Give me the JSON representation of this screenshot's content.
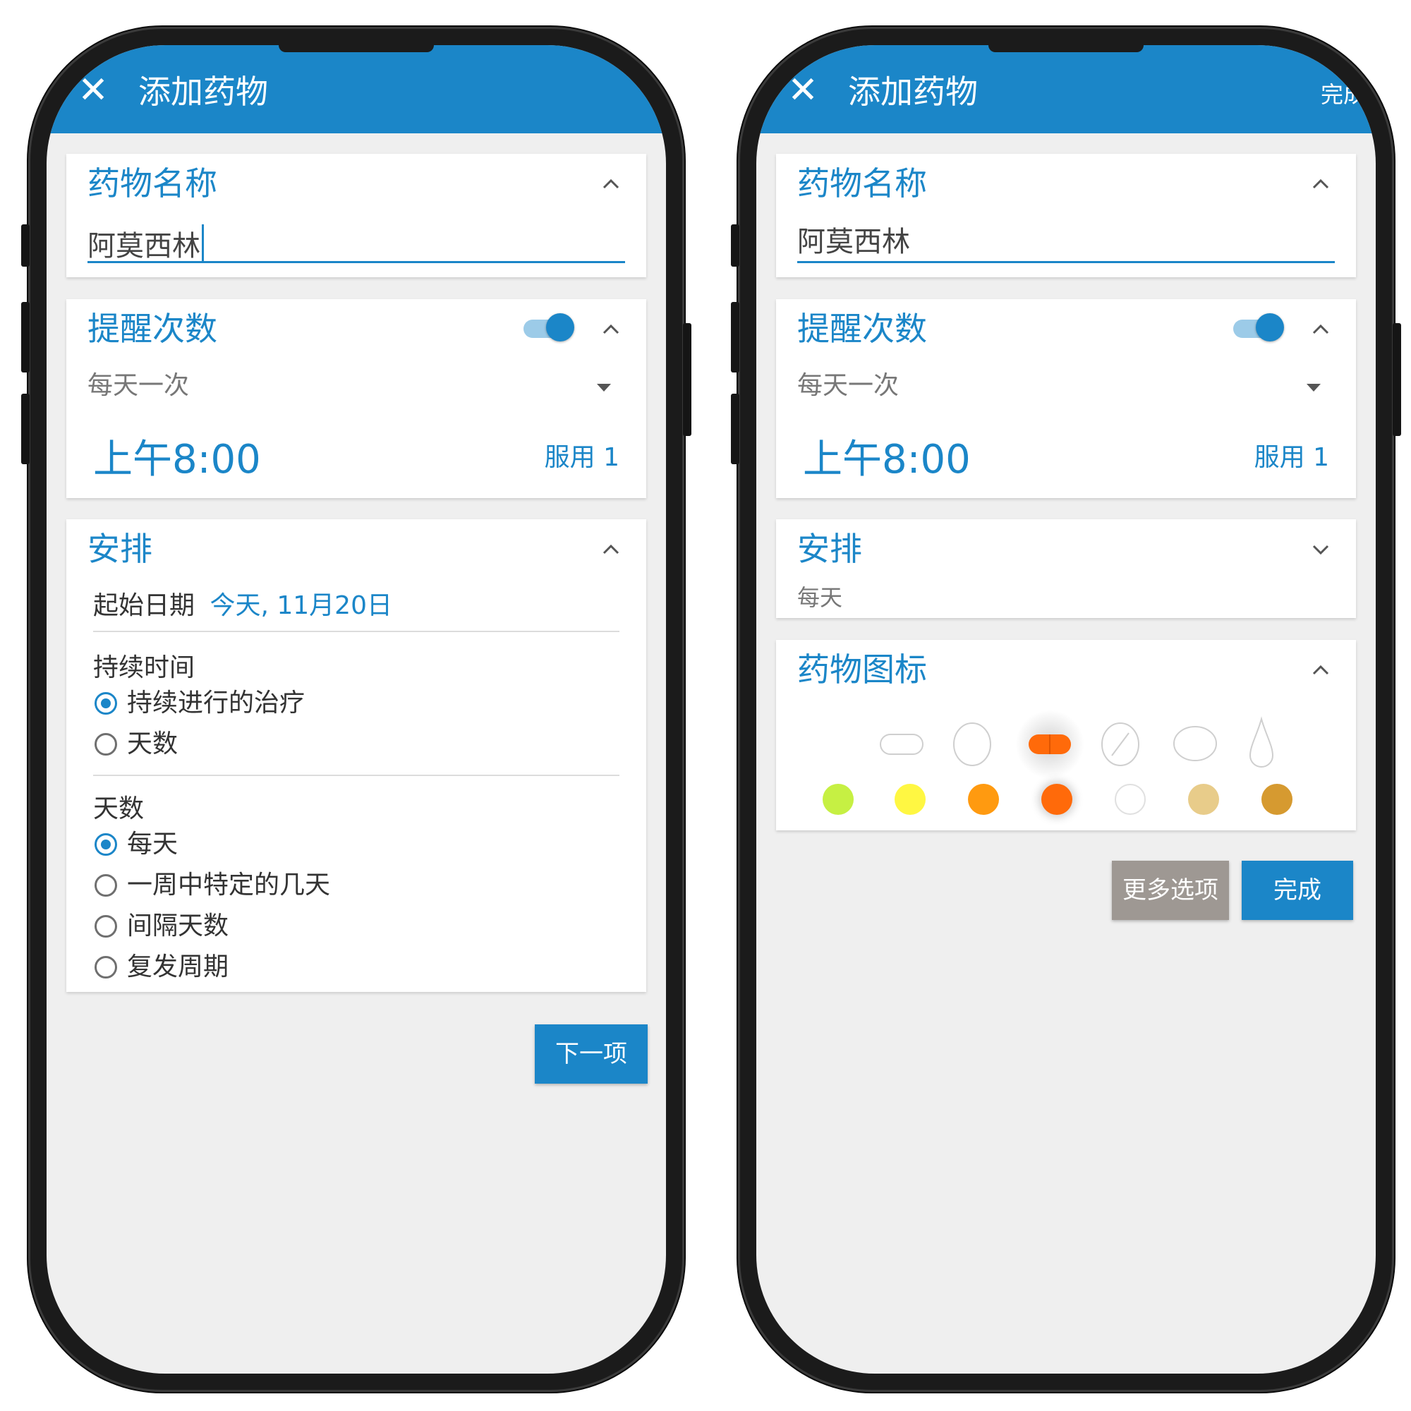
{
  "left": {
    "appbar": {
      "title": "添加药物"
    },
    "med_name": {
      "title": "药物名称",
      "value": "阿莫西林"
    },
    "reminders": {
      "title": "提醒次数",
      "frequency": "每天一次",
      "time": "上午8:00",
      "dose": "服用 1",
      "enabled": true
    },
    "schedule": {
      "title": "安排",
      "start_date_label": "起始日期",
      "start_date_value": "今天, 11月20日",
      "duration_label": "持续时间",
      "duration_options": [
        {
          "label": "持续进行的治疗",
          "selected": true
        },
        {
          "label": "天数",
          "selected": false
        }
      ],
      "days_label": "天数",
      "days_options": [
        {
          "label": "每天",
          "selected": true
        },
        {
          "label": "一周中特定的几天",
          "selected": false
        },
        {
          "label": "间隔天数",
          "selected": false
        },
        {
          "label": "复发周期",
          "selected": false
        }
      ]
    },
    "next_button": "下一项"
  },
  "right": {
    "appbar": {
      "title": "添加药物",
      "done": "完成"
    },
    "med_name": {
      "title": "药物名称",
      "value": "阿莫西林"
    },
    "reminders": {
      "title": "提醒次数",
      "frequency": "每天一次",
      "time": "上午8:00",
      "dose": "服用 1",
      "enabled": true
    },
    "schedule": {
      "title": "安排",
      "summary": "每天"
    },
    "icon_section": {
      "title": "药物图标",
      "shapes": [
        "capsule-oblong-icon",
        "round-pill-icon",
        "capsule-icon",
        "scored-tablet-icon",
        "oval-pill-icon",
        "drop-icon"
      ],
      "selected_shape": "capsule-icon",
      "colors": [
        "#c6f043",
        "#fff742",
        "#ff9a10",
        "#ff6a0a",
        "#ffffff",
        "#e8cc8a",
        "#d69a30"
      ],
      "selected_color": "#ff6a0a"
    },
    "more_options_button": "更多选项",
    "done_button": "完成"
  },
  "colors": {
    "primary": "#1b86c8",
    "grey_button": "#9e9893",
    "background": "#efefef"
  }
}
